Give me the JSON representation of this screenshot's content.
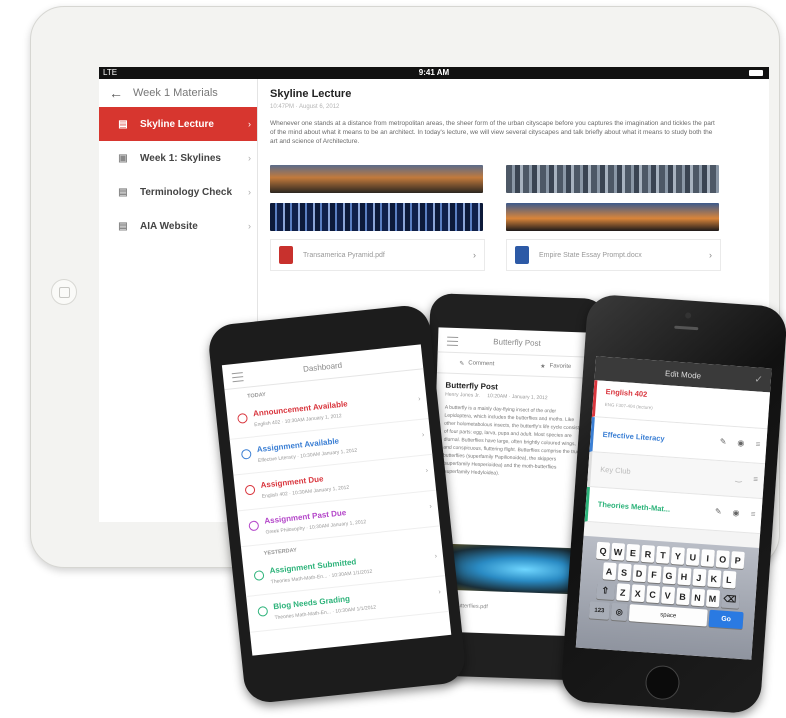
{
  "tablet": {
    "status": {
      "signal": "LTE",
      "time": "9:41 AM"
    },
    "sidebar": {
      "header": "Week 1 Materials",
      "items": [
        {
          "label": "Skyline Lecture",
          "icon": "document-icon",
          "active": true
        },
        {
          "label": "Week 1: Skylines",
          "icon": "chat-icon",
          "active": false
        },
        {
          "label": "Terminology Check",
          "icon": "checklist-icon",
          "active": false
        },
        {
          "label": "AIA Website",
          "icon": "link-icon",
          "active": false
        }
      ]
    },
    "content": {
      "title": "Skyline Lecture",
      "meta": "10:47PM · August 6, 2012",
      "body": "Whenever one stands at a distance from metropolitan areas, the sheer form of the urban cityscape before you captures the imagination and tickles the part of the mind about what it means to be an architect. In today's lecture, we will view several cityscapes and talk briefly about what it means to study both the art and science of Architecture.",
      "attachments": [
        {
          "name": "Transamerica Pyramid.pdf",
          "color": "#c8312d"
        },
        {
          "name": "Empire State Essay Prompt.docx",
          "color": "#2d5aa6"
        }
      ]
    }
  },
  "phone_dashboard": {
    "title": "Dashboard",
    "today_label": "TODAY",
    "yesterday_label": "YESTERDAY",
    "items": [
      {
        "title": "Announcement Available",
        "sub": "English 402 · 10:30AM January 1, 2012",
        "color": "#d9363e"
      },
      {
        "title": "Assignment Available",
        "sub": "Effective Literacy · 10:30AM January 1, 2012",
        "color": "#3b7fd4"
      },
      {
        "title": "Assignment Due",
        "sub": "English 402 · 10:30AM January 1, 2012",
        "color": "#d9363e"
      },
      {
        "title": "Assignment Past Due",
        "sub": "Greek Philosophy · 10:30AM January 1, 2012",
        "color": "#b447c9"
      },
      {
        "title": "Assignment Submitted",
        "sub": "Theories Math-Math-En... · 10:30AM 1/1/2012",
        "color": "#2db37a"
      },
      {
        "title": "Blog Needs Grading",
        "sub": "Theories Math-Math-En... · 10:30AM 1/1/2012",
        "color": "#2db37a"
      }
    ]
  },
  "phone_post": {
    "title": "Butterfly Post",
    "tabs": {
      "comment": "Comment",
      "favorite": "Favorite"
    },
    "post_title": "Butterfly Post",
    "author": "Henry Jones Jr.",
    "date": "10:20AM · January 1, 2012",
    "body": "A butterfly is a mainly day-flying insect of the order Lepidoptera, which includes the butterflies and moths. Like other holometabolous insects, the butterfly's life cycle consists of four parts: egg, larva, pupa and adult. Most species are diurnal. Butterflies have large, often brightly coloured wings, and conspicuous, fluttering flight. Butterflies comprise the true butterflies (superfamily Papilionoidea), the skippers (superfamily Hesperioidea) and the moth-butterflies (superfamily Hedyloidea).",
    "attachment": "butterflies.pdf"
  },
  "phone_edit": {
    "title": "Edit Mode",
    "items": [
      {
        "label": "English 402",
        "sub": "ENG F307-404 (lecture)",
        "color": "#d9363e"
      },
      {
        "label": "Effective Literacy",
        "sub": "",
        "color": "#3b7fd4"
      },
      {
        "label": "Key Club",
        "sub": "",
        "color": "#bbbbbb"
      },
      {
        "label": "Theories Meth-Mat...",
        "sub": "",
        "color": "#2db37a"
      }
    ],
    "keyboard": {
      "row1": [
        "Q",
        "W",
        "E",
        "R",
        "T",
        "Y",
        "U",
        "I",
        "O",
        "P"
      ],
      "row2": [
        "A",
        "S",
        "D",
        "F",
        "G",
        "H",
        "J",
        "K",
        "L"
      ],
      "row3": [
        "Z",
        "X",
        "C",
        "V",
        "B",
        "N",
        "M"
      ],
      "num": "123",
      "space": "space",
      "go": "Go"
    }
  }
}
